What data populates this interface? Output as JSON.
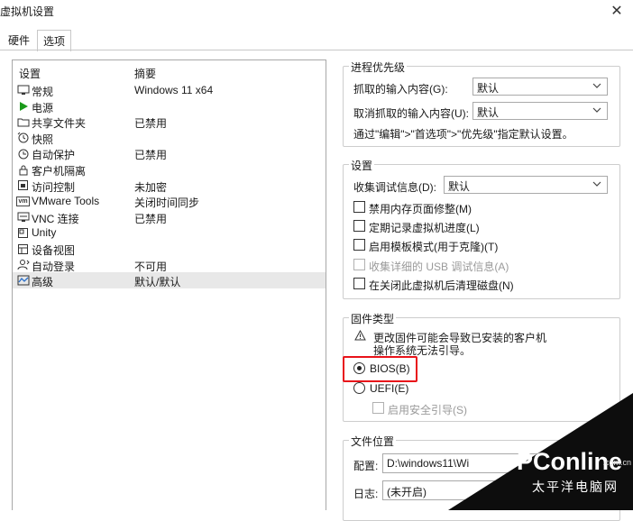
{
  "window": {
    "title": "虚拟机设置",
    "close_glyph": "✕"
  },
  "tabs": [
    {
      "label": "硬件"
    },
    {
      "label": "选项"
    }
  ],
  "list": {
    "header_setting": "设置",
    "header_summary": "摘要",
    "items": [
      {
        "name": "常规",
        "summary": "Windows 11 x64",
        "icon": "monitor-icon"
      },
      {
        "name": "电源",
        "summary": "",
        "icon": "play-icon"
      },
      {
        "name": "共享文件夹",
        "summary": "已禁用",
        "icon": "folder-icon"
      },
      {
        "name": "快照",
        "summary": "",
        "icon": "snapshot-icon"
      },
      {
        "name": "自动保护",
        "summary": "已禁用",
        "icon": "clock-icon"
      },
      {
        "name": "客户机隔离",
        "summary": "",
        "icon": "lock-icon"
      },
      {
        "name": "访问控制",
        "summary": "未加密",
        "icon": "access-icon"
      },
      {
        "name": "VMware Tools",
        "summary": "关闭时间同步",
        "icon": "vm-icon"
      },
      {
        "name": "VNC 连接",
        "summary": "已禁用",
        "icon": "vnc-icon"
      },
      {
        "name": "Unity",
        "summary": "",
        "icon": "unity-icon"
      },
      {
        "name": "设备视图",
        "summary": "",
        "icon": "device-view-icon"
      },
      {
        "name": "自动登录",
        "summary": "不可用",
        "icon": "user-icon"
      },
      {
        "name": "高级",
        "summary": "默认/默认",
        "icon": "advanced-icon"
      }
    ]
  },
  "process_priority": {
    "legend": "进程优先级",
    "grabbed_label": "抓取的输入内容(G):",
    "grabbed_value": "默认",
    "ungrabbed_label": "取消抓取的输入内容(U):",
    "ungrabbed_value": "默认",
    "hint": "通过\"编辑\">\"首选项\">\"优先级\"指定默认设置。"
  },
  "settings": {
    "legend": "设置",
    "debug_label": "收集调试信息(D):",
    "debug_value": "默认",
    "checkboxes": [
      {
        "label": "禁用内存页面修整(M)",
        "disabled": false
      },
      {
        "label": "定期记录虚拟机进度(L)",
        "disabled": false
      },
      {
        "label": "启用模板模式(用于克隆)(T)",
        "disabled": false
      },
      {
        "label": "收集详细的 USB 调试信息(A)",
        "disabled": true
      },
      {
        "label": "在关闭此虚拟机后清理磁盘(N)",
        "disabled": false
      }
    ]
  },
  "firmware": {
    "legend": "固件类型",
    "warning_line1": "更改固件可能会导致已安装的客户机",
    "warning_line2": "操作系统无法引导。",
    "bios_label": "BIOS(B)",
    "uefi_label": "UEFI(E)",
    "secure_boot_label": "启用安全引导(S)",
    "selected": "BIOS"
  },
  "file_location": {
    "legend": "文件位置",
    "config_label": "配置:",
    "config_value": "D:\\windows11\\Wi",
    "log_label": "日志:",
    "log_value": "(未开启)"
  },
  "watermark": {
    "brand": "PConline",
    "domain": ".com.cn",
    "chinese": "太平洋电脑网"
  },
  "colors": {
    "highlight": "#e8131a",
    "play_green": "#1a9a1a"
  }
}
